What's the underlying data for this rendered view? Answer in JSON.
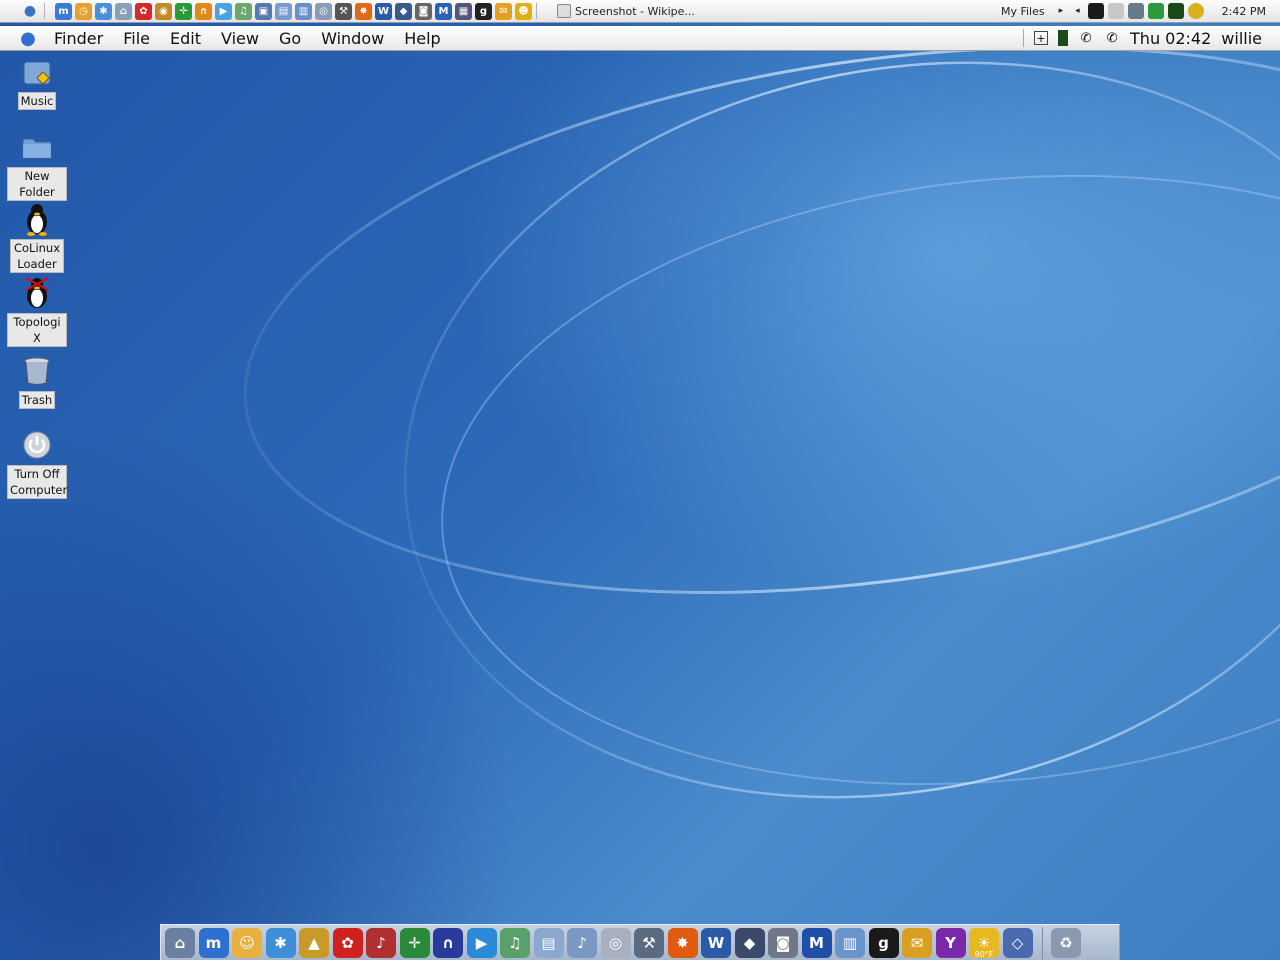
{
  "taskstrip": {
    "task_title": "Screenshot - Wikipe...",
    "myfiles_label": "My Files",
    "clock": "2:42 PM",
    "quicklaunch": [
      {
        "name": "msn-icon",
        "glyph": "m",
        "color": "#3a7bd5"
      },
      {
        "name": "clock-icon",
        "glyph": "◷",
        "color": "#e6a22e"
      },
      {
        "name": "messenger-icon",
        "glyph": "✱",
        "color": "#4a90d8"
      },
      {
        "name": "network-icon",
        "glyph": "⌂",
        "color": "#8aa0b8"
      },
      {
        "name": "flower-icon",
        "glyph": "✿",
        "color": "#d22a2a"
      },
      {
        "name": "gnome-icon",
        "glyph": "◉",
        "color": "#c48a2a"
      },
      {
        "name": "target-icon",
        "glyph": "✛",
        "color": "#2a9a3a"
      },
      {
        "name": "headphones-icon",
        "glyph": "∩",
        "color": "#e08a1a"
      },
      {
        "name": "play-icon",
        "glyph": "▶",
        "color": "#4aa3e0"
      },
      {
        "name": "itunes-icon",
        "glyph": "♫",
        "color": "#6aa870"
      },
      {
        "name": "screen-icon",
        "glyph": "▣",
        "color": "#5a78b0"
      },
      {
        "name": "document-icon",
        "glyph": "▤",
        "color": "#7a9ccc"
      },
      {
        "name": "folder-icon",
        "glyph": "▥",
        "color": "#6a8fc4"
      },
      {
        "name": "dvd-icon",
        "glyph": "◎",
        "color": "#8a9ab8"
      },
      {
        "name": "tools-icon",
        "glyph": "⚒",
        "color": "#555"
      },
      {
        "name": "burn-icon",
        "glyph": "✸",
        "color": "#e06a1a"
      },
      {
        "name": "word-icon",
        "glyph": "W",
        "color": "#2a5aa8"
      },
      {
        "name": "cube-icon",
        "glyph": "◆",
        "color": "#3a5a8a"
      },
      {
        "name": "camera-icon",
        "glyph": "◙",
        "color": "#666"
      },
      {
        "name": "mail-m-icon",
        "glyph": "M",
        "color": "#2a62b8"
      },
      {
        "name": "photos-icon",
        "glyph": "▦",
        "color": "#557"
      },
      {
        "name": "g-icon",
        "glyph": "g",
        "color": "#222"
      },
      {
        "name": "mail-icon",
        "glyph": "✉",
        "color": "#e4a020"
      },
      {
        "name": "smiley-icon",
        "glyph": "☻",
        "color": "#e0b010"
      }
    ]
  },
  "menubar": {
    "app": "Finder",
    "menus": [
      "File",
      "Edit",
      "View",
      "Go",
      "Window",
      "Help"
    ],
    "clock": "Thu 02:42",
    "user": "willie"
  },
  "desktop_icons": [
    {
      "name": "music-folder",
      "label": "Music"
    },
    {
      "name": "new-folder",
      "label": "New Folder"
    },
    {
      "name": "colinux-loader",
      "label": "CoLinux Loader"
    },
    {
      "name": "topologi-x",
      "label": "Topologi X"
    },
    {
      "name": "trash",
      "label": "Trash"
    },
    {
      "name": "turn-off-computer",
      "label": "Turn Off Computer"
    }
  ],
  "dock": {
    "items": [
      {
        "name": "home-icon",
        "glyph": "⌂",
        "color": "#6b7fa0"
      },
      {
        "name": "msn-icon",
        "glyph": "m",
        "color": "#2f6fcf"
      },
      {
        "name": "contacts-icon",
        "glyph": "☺",
        "color": "#e8b040"
      },
      {
        "name": "people-icon",
        "glyph": "✱",
        "color": "#3f8fd8"
      },
      {
        "name": "triangle-app-icon",
        "glyph": "▲",
        "color": "#c89a2a"
      },
      {
        "name": "flower-icon",
        "glyph": "✿",
        "color": "#d02020"
      },
      {
        "name": "music-ex-icon",
        "glyph": "♪",
        "color": "#b03030"
      },
      {
        "name": "target-icon",
        "glyph": "✛",
        "color": "#2a8a3a"
      },
      {
        "name": "headphones-icon",
        "glyph": "∩",
        "color": "#2a3a9a"
      },
      {
        "name": "media-player-icon",
        "glyph": "▶",
        "color": "#2a8ad8"
      },
      {
        "name": "itunes-icon",
        "glyph": "♫",
        "color": "#5aa06a"
      },
      {
        "name": "documents-icon",
        "glyph": "▤",
        "color": "#8aa8d0"
      },
      {
        "name": "music-folder-icon",
        "glyph": "♪",
        "color": "#7a98c4"
      },
      {
        "name": "dvd-icon",
        "glyph": "◎",
        "color": "#a8b0c0"
      },
      {
        "name": "tools-icon",
        "glyph": "⚒",
        "color": "#5a6a80"
      },
      {
        "name": "burn-icon",
        "glyph": "✸",
        "color": "#e05a10"
      },
      {
        "name": "word-icon",
        "glyph": "W",
        "color": "#2a5aa8"
      },
      {
        "name": "cube-icon",
        "glyph": "◆",
        "color": "#3a4a6a"
      },
      {
        "name": "camera-icon",
        "glyph": "◙",
        "color": "#707888"
      },
      {
        "name": "mail-m-icon",
        "glyph": "M",
        "color": "#1f4fa8"
      },
      {
        "name": "folder-icon",
        "glyph": "▥",
        "color": "#6a94cc"
      },
      {
        "name": "g-icon",
        "glyph": "g",
        "color": "#1a1a1a"
      },
      {
        "name": "mail-icon",
        "glyph": "✉",
        "color": "#d8a020"
      },
      {
        "name": "yahoo-icon",
        "glyph": "Y",
        "color": "#7a2aa8"
      },
      {
        "name": "weather-icon",
        "glyph": "☀",
        "color": "#e8b820"
      },
      {
        "name": "box-icon",
        "glyph": "◇",
        "color": "#4a6ab0"
      }
    ],
    "trash": {
      "name": "trash-icon",
      "glyph": "♻",
      "color": "#8a98b0"
    },
    "weather_temp": "90°F"
  }
}
